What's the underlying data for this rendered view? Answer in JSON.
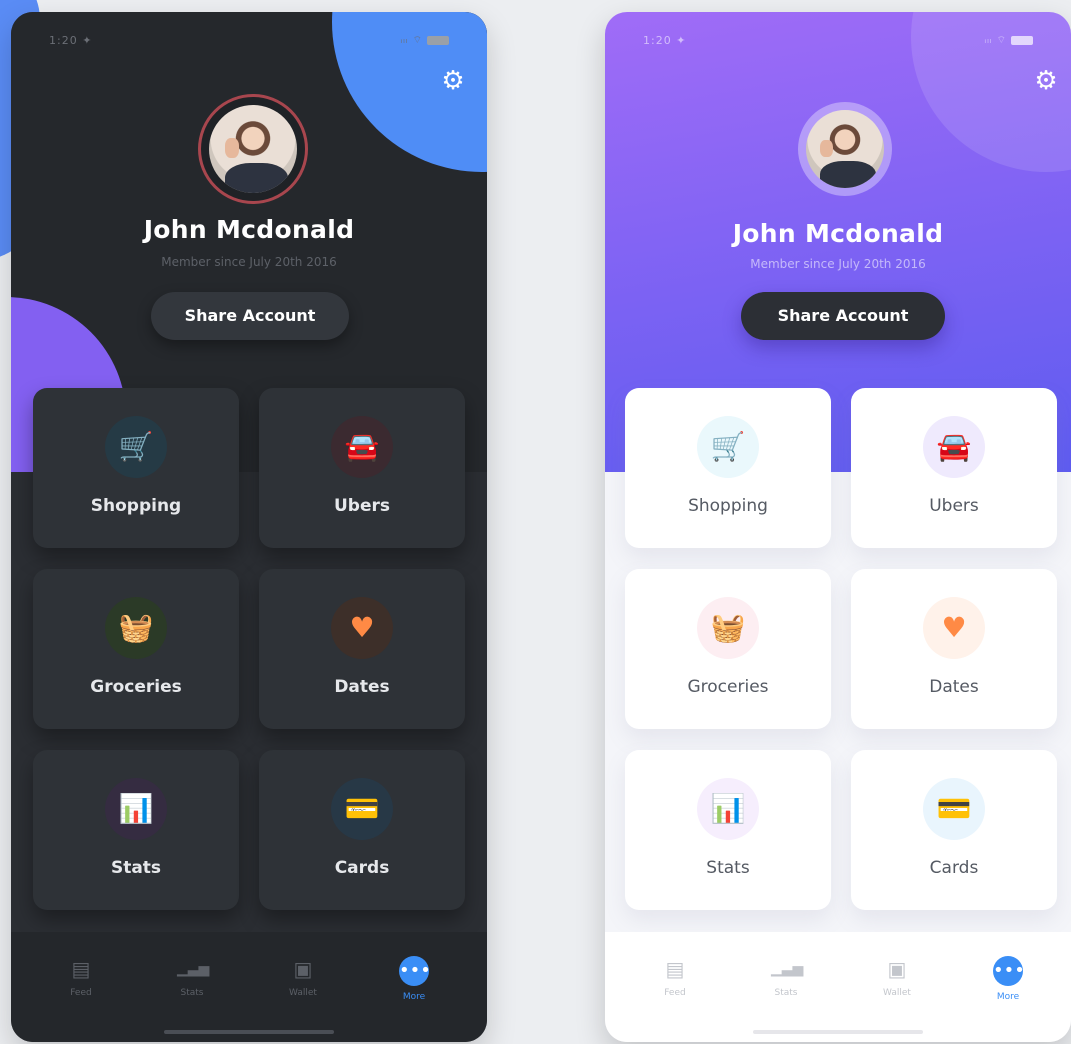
{
  "phones": {
    "dark": {
      "status": {
        "time": "1:20 ✦",
        "system": "ᵢₗₗ ⌔"
      },
      "profile": {
        "name": "John Mcdonald",
        "member_since": "Member since July 20th 2016"
      },
      "share_label": "Share Account",
      "tiles": [
        {
          "label": "Shopping",
          "icon": "cart-icon",
          "glyph": "🛒",
          "color": "#27b4d8",
          "bg": "#253a45"
        },
        {
          "label": "Ubers",
          "icon": "car-icon",
          "glyph": "🚘",
          "color": "#ef5b78",
          "bg": "#3b2a30"
        },
        {
          "label": "Groceries",
          "icon": "basket-icon",
          "glyph": "🧺",
          "color": "#6ad12a",
          "bg": "#2b3a27"
        },
        {
          "label": "Dates",
          "icon": "heart-icon",
          "glyph": "♥",
          "color": "#ff8a45",
          "bg": "#3d2f29"
        },
        {
          "label": "Stats",
          "icon": "bar-chart-icon",
          "glyph": "📊",
          "color": "#b06cf0",
          "bg": "#352c41"
        },
        {
          "label": "Cards",
          "icon": "card-icon",
          "glyph": "💳",
          "color": "#35a7ee",
          "bg": "#273846"
        }
      ],
      "nav": [
        {
          "label": "Feed",
          "icon": "feed-icon",
          "glyph": "▤"
        },
        {
          "label": "Stats",
          "icon": "stats-icon",
          "glyph": "▁▃▅"
        },
        {
          "label": "Wallet",
          "icon": "wallet-icon",
          "glyph": "▣"
        },
        {
          "label": "More",
          "icon": "more-icon",
          "glyph": "•••",
          "active": true
        }
      ]
    },
    "light": {
      "status": {
        "time": "1:20 ✦",
        "system": "ᵢₗₗ ⌔"
      },
      "profile": {
        "name": "John Mcdonald",
        "member_since": "Member since July 20th 2016"
      },
      "share_label": "Share Account",
      "tiles": [
        {
          "label": "Shopping",
          "icon": "cart-icon",
          "glyph": "🛒",
          "color": "#2aaad4",
          "bg": "#eaf8fc"
        },
        {
          "label": "Ubers",
          "icon": "car-icon",
          "glyph": "🚘",
          "color": "#6a4ef0",
          "bg": "#efeafd"
        },
        {
          "label": "Groceries",
          "icon": "basket-icon",
          "glyph": "🧺",
          "color": "#f0507a",
          "bg": "#fdeef2"
        },
        {
          "label": "Dates",
          "icon": "heart-icon",
          "glyph": "♥",
          "color": "#ff8a45",
          "bg": "#fff2ea"
        },
        {
          "label": "Stats",
          "icon": "bar-chart-icon",
          "glyph": "📊",
          "color": "#b06cf0",
          "bg": "#f6eefd"
        },
        {
          "label": "Cards",
          "icon": "card-icon",
          "glyph": "💳",
          "color": "#35a7ee",
          "bg": "#e9f5fd"
        }
      ],
      "nav": [
        {
          "label": "Feed",
          "icon": "feed-icon",
          "glyph": "▤"
        },
        {
          "label": "Stats",
          "icon": "stats-icon",
          "glyph": "▁▃▅"
        },
        {
          "label": "Wallet",
          "icon": "wallet-icon",
          "glyph": "▣"
        },
        {
          "label": "More",
          "icon": "more-icon",
          "glyph": "•••",
          "active": true
        }
      ]
    }
  }
}
